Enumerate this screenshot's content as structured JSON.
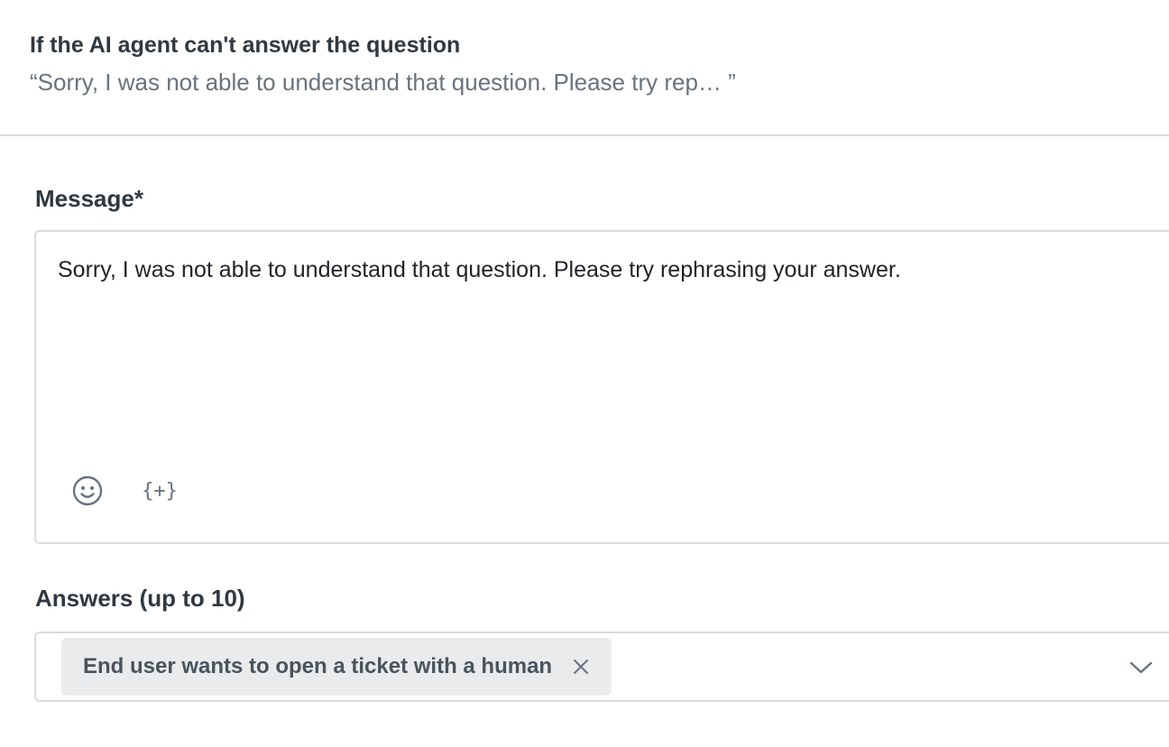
{
  "section": {
    "title": "If the AI agent can't answer the question",
    "summary": "“Sorry, I was not able to understand that question. Please try rep…  ”"
  },
  "message": {
    "label": "Message*",
    "value": "Sorry, I was not able to understand that question. Please try rephrasing your answer.",
    "toolbar": {
      "emoji_icon": "smiley-icon",
      "variable_icon": "curly-plus-icon",
      "variable_glyph": "{+}"
    }
  },
  "answers": {
    "label": "Answers (up to 10)",
    "tags": [
      {
        "label": "End user wants to open a ticket with a human"
      }
    ],
    "dropdown_icon": "chevron-down-icon"
  }
}
